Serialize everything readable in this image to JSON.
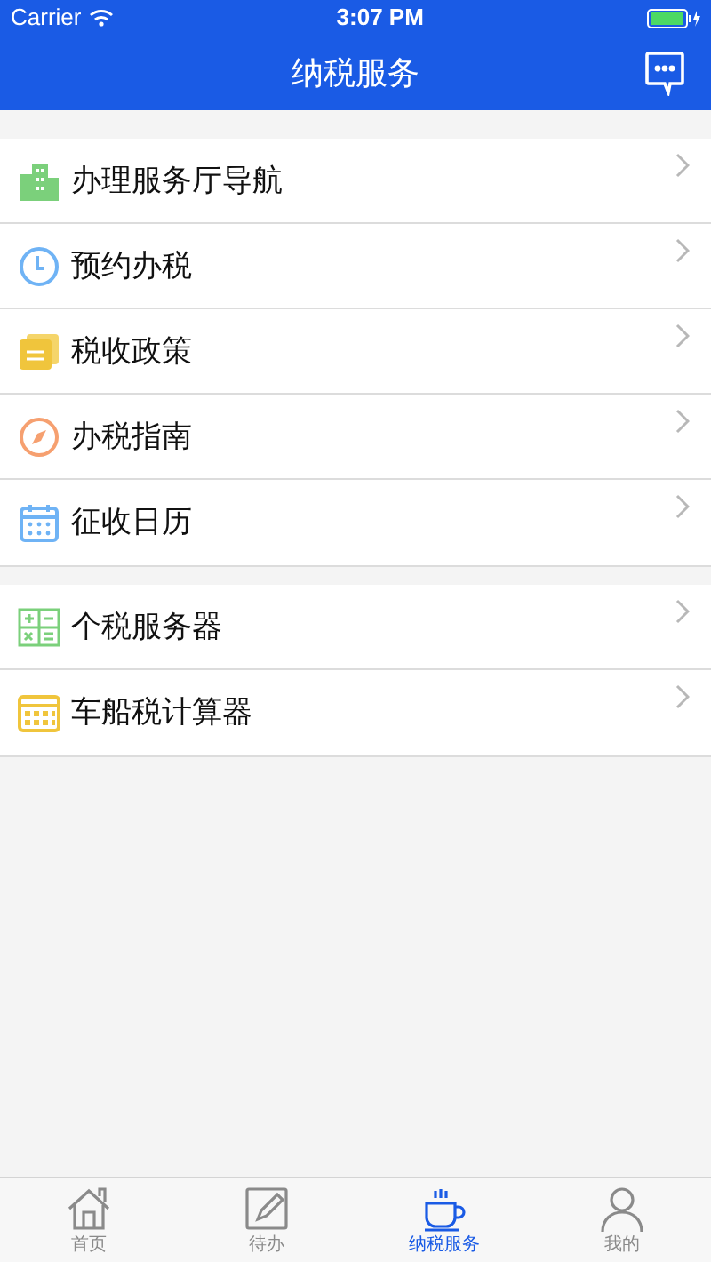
{
  "status_bar": {
    "carrier": "Carrier",
    "time": "3:07 PM"
  },
  "nav": {
    "title": "纳税服务"
  },
  "groups": [
    {
      "items": [
        {
          "kind": "building",
          "label": "办理服务厅导航"
        },
        {
          "kind": "clock",
          "label": "预约办税"
        },
        {
          "kind": "document",
          "label": "税收政策"
        },
        {
          "kind": "compass",
          "label": "办税指南"
        },
        {
          "kind": "calendar",
          "label": "征收日历"
        }
      ]
    },
    {
      "items": [
        {
          "kind": "calculator",
          "label": "个税服务器"
        },
        {
          "kind": "keypad",
          "label": "车船税计算器"
        }
      ]
    }
  ],
  "tabs": [
    {
      "kind": "home",
      "label": "首页",
      "selected": false
    },
    {
      "kind": "edit",
      "label": "待办",
      "selected": false
    },
    {
      "kind": "cup",
      "label": "纳税服务",
      "selected": true
    },
    {
      "kind": "person",
      "label": "我的",
      "selected": false
    }
  ]
}
